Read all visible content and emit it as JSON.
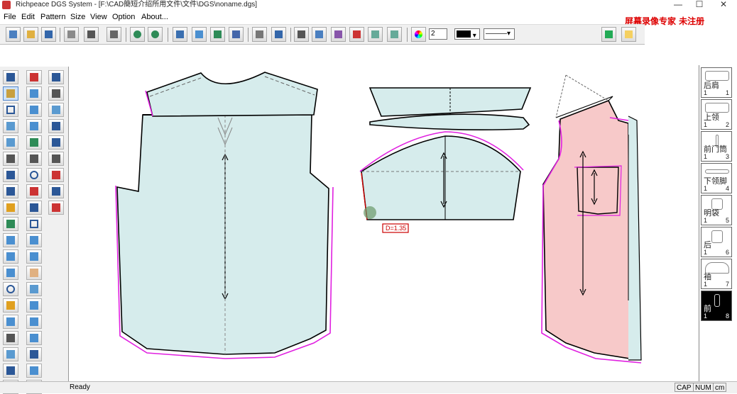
{
  "window": {
    "title": "Richpeace DGS System - [F:\\CAD簡短介绍所用文件\\文件\\DGS\\noname.dgs]",
    "minimize_glyph": "—",
    "maximize_glyph": "☐",
    "close_glyph": "✕"
  },
  "menu": [
    "File",
    "Edit",
    "Pattern",
    "Size",
    "View",
    "Option",
    "About..."
  ],
  "watermark": "屏幕录像专家  未注册",
  "toolbar": {
    "line_width_value": "2",
    "color_swatch": "#000000",
    "line_style_label": "———"
  },
  "measure_label": "D=1.35",
  "pieces": [
    {
      "name": "后肩",
      "count": "1",
      "qty": "1"
    },
    {
      "name": "上领",
      "count": "1",
      "qty": "2"
    },
    {
      "name": "前门筒",
      "count": "1",
      "qty": "3"
    },
    {
      "name": "下领脚",
      "count": "1",
      "qty": "4"
    },
    {
      "name": "明袋",
      "count": "1",
      "qty": "5"
    },
    {
      "name": "后",
      "count": "1",
      "qty": "6"
    },
    {
      "name": "袖",
      "count": "1",
      "qty": "7"
    },
    {
      "name": "前",
      "count": "1",
      "qty": "8"
    }
  ],
  "status": {
    "text": "Ready",
    "cap": "CAP",
    "num": "NUM",
    "unit": "cm"
  },
  "colors": {
    "piece_fill_blue": "#d6ecec",
    "piece_fill_pink": "#f7c9c9",
    "seam_magenta": "#e020e0",
    "outline": "#000000",
    "watermark_red": "#dd0000"
  }
}
